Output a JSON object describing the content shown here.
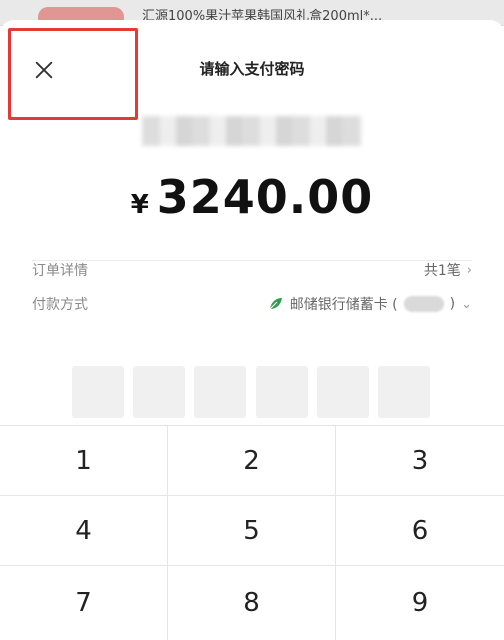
{
  "background": {
    "title": "汇源100%果汁苹果韩国风礼盒200ml*..."
  },
  "sheet": {
    "title": "请输入支付密码",
    "close_icon": "close-icon"
  },
  "payment": {
    "currency": "¥",
    "amount": "3240.00"
  },
  "order": {
    "details_label": "订单详情",
    "details_value": "共1笔",
    "method_label": "付款方式",
    "method_bank": "邮储银行储蓄卡 (",
    "method_close": ")"
  },
  "pin": {
    "length": 6
  },
  "keypad": {
    "keys": [
      "1",
      "2",
      "3",
      "4",
      "5",
      "6",
      "7",
      "8",
      "9"
    ]
  },
  "colors": {
    "accent_highlight": "#e53935",
    "bank_green": "#2e9e4f"
  }
}
